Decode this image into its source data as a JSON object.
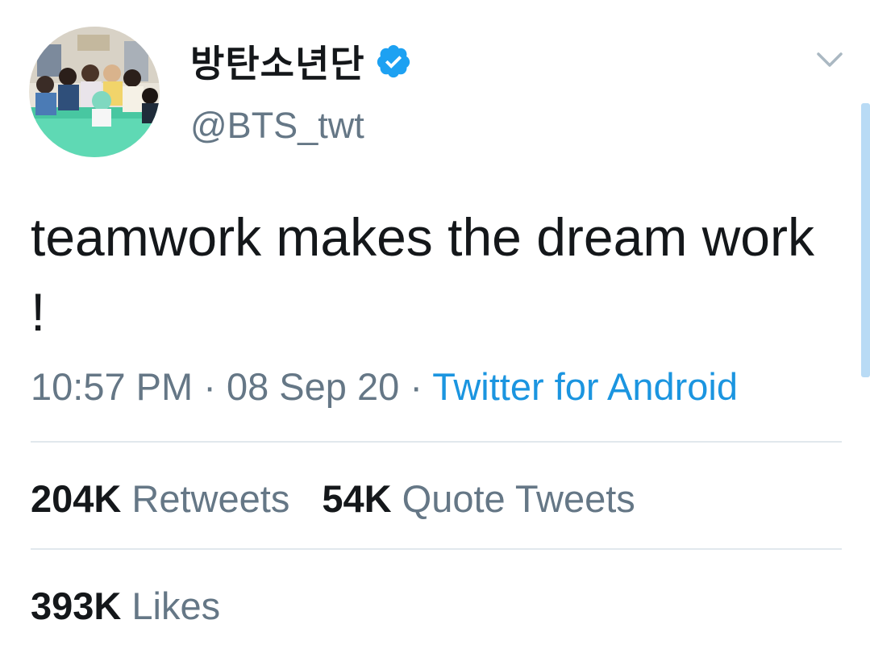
{
  "user": {
    "display_name": "방탄소년단",
    "handle": "@BTS_twt",
    "verified": true,
    "verified_icon": "verified-badge-icon",
    "avatar": "group-photo-avatar"
  },
  "header": {
    "menu_icon": "chevron-down-icon"
  },
  "tweet": {
    "text": "teamwork makes the dream work !",
    "time": "10:57 PM",
    "separator": " · ",
    "date": "08 Sep 20",
    "source": "Twitter for Android"
  },
  "stats": {
    "retweets_count": "204K",
    "retweets_label": "Retweets",
    "quotes_count": "54K",
    "quotes_label": "Quote Tweets",
    "likes_count": "393K",
    "likes_label": "Likes"
  },
  "colors": {
    "accent": "#1b95e0",
    "text_primary": "#14171a",
    "text_secondary": "#657786",
    "divider": "#e1e8ed",
    "verified": "#1da1f2"
  }
}
